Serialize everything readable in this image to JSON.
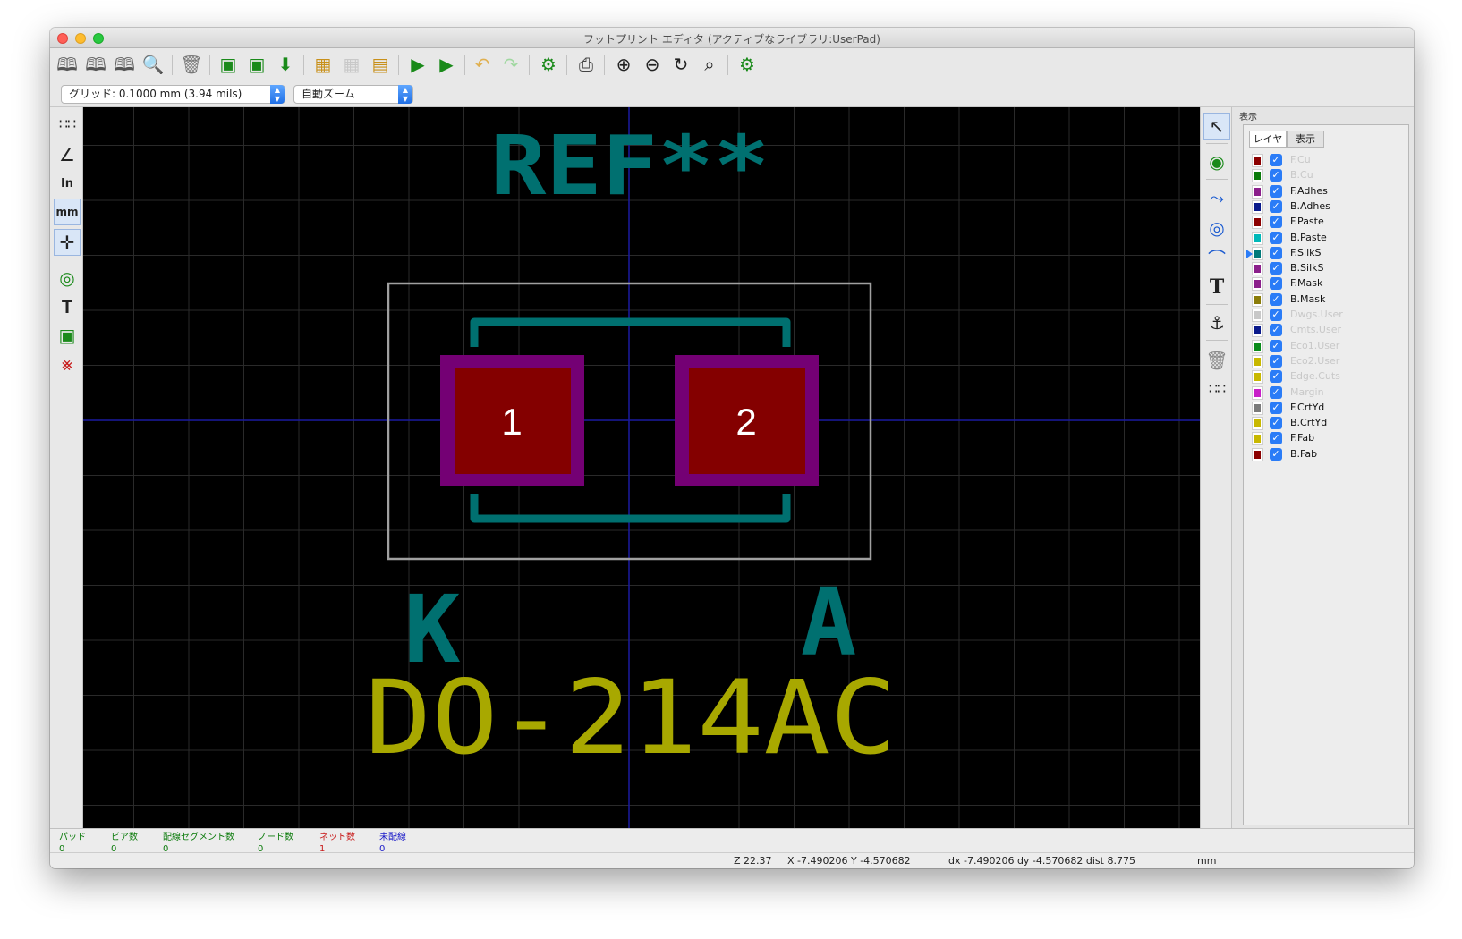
{
  "window": {
    "title": "フットプリント エディタ (アクティブなライブラリ:UserPad)"
  },
  "colors": {
    "canvas_bg": "#000000",
    "silk": "#007070",
    "fab": "#a8a800",
    "pad": "#840000",
    "mask": "#740074",
    "courtyard": "#a0a0a0",
    "axis": "#1a1aa0",
    "grid": "#2a2a2a"
  },
  "toolbar": {
    "icons": [
      "new-library-icon",
      "save-library-icon",
      "open-library-icon",
      "library-browser-icon",
      "delete-icon",
      "new-footprint-icon",
      "create-footprint-wizard-icon",
      "import-footprint-icon",
      "export-footprint-icon",
      "save-footprint-icon",
      "load-from-board-icon",
      "footprint-properties-icon",
      "insert-into-board-icon",
      "update-board-icon",
      "undo-icon",
      "redo-icon",
      "settings-icon",
      "print-icon",
      "zoom-in-icon",
      "zoom-out-icon",
      "redraw-icon",
      "zoom-fit-icon",
      "check-footprint-icon"
    ]
  },
  "options": {
    "grid_value": "グリッド: 0.1000 mm (3.94 mils)",
    "zoom_value": "自動ズーム"
  },
  "left_tools": [
    "grid-toggle-icon",
    "polar-coords-icon",
    "inch-units-icon",
    "mm-units-icon",
    "cursor-shape-icon",
    "pad-sketch-icon",
    "text-sketch-icon",
    "edge-sketch-icon",
    "high-contrast-icon"
  ],
  "left_texts": {
    "inch": "In",
    "mm": "mm"
  },
  "right_tools": [
    "select-arrow-icon",
    "add-pad-icon",
    "add-line-icon",
    "add-circle-icon",
    "add-arc-icon",
    "add-text-icon",
    "anchor-icon",
    "delete-tool-icon",
    "grid-origin-icon"
  ],
  "right_texts": {
    "text_tool": "T"
  },
  "footprint": {
    "ref": "REF**",
    "value": "DO-214AC",
    "cathode": "K",
    "anode": "A",
    "pad1": "1",
    "pad2": "2"
  },
  "panel": {
    "title": "表示",
    "tabs": [
      "レイヤ",
      "表示"
    ],
    "layers": [
      {
        "name": "F.Cu",
        "color": "#8b0000",
        "enabled": false
      },
      {
        "name": "B.Cu",
        "color": "#0a7a0a",
        "enabled": false
      },
      {
        "name": "F.Adhes",
        "color": "#8b1f8b",
        "enabled": true
      },
      {
        "name": "B.Adhes",
        "color": "#0a1a8b",
        "enabled": true
      },
      {
        "name": "F.Paste",
        "color": "#8b0000",
        "enabled": true
      },
      {
        "name": "B.Paste",
        "color": "#00b8b8",
        "enabled": true
      },
      {
        "name": "F.SilkS",
        "color": "#007a7a",
        "enabled": true,
        "active": true
      },
      {
        "name": "B.SilkS",
        "color": "#8b1f8b",
        "enabled": true
      },
      {
        "name": "F.Mask",
        "color": "#8b1f8b",
        "enabled": true
      },
      {
        "name": "B.Mask",
        "color": "#8b7d0a",
        "enabled": true
      },
      {
        "name": "Dwgs.User",
        "color": "#c8c8c8",
        "enabled": false
      },
      {
        "name": "Cmts.User",
        "color": "#0a1a8b",
        "enabled": false
      },
      {
        "name": "Eco1.User",
        "color": "#0a8b1a",
        "enabled": false
      },
      {
        "name": "Eco2.User",
        "color": "#c8b800",
        "enabled": false
      },
      {
        "name": "Edge.Cuts",
        "color": "#c8b800",
        "enabled": false
      },
      {
        "name": "Margin",
        "color": "#c81fc8",
        "enabled": false
      },
      {
        "name": "F.CrtYd",
        "color": "#7a7a7a",
        "enabled": true
      },
      {
        "name": "B.CrtYd",
        "color": "#c8b800",
        "enabled": true
      },
      {
        "name": "F.Fab",
        "color": "#c8b800",
        "enabled": true
      },
      {
        "name": "B.Fab",
        "color": "#8b0000",
        "enabled": true
      }
    ]
  },
  "status": {
    "fields": [
      {
        "label": "パッド",
        "value": "0",
        "color": "#0a7a0a"
      },
      {
        "label": "ビア数",
        "value": "0",
        "color": "#0a7a0a"
      },
      {
        "label": "配線セグメント数",
        "value": "0",
        "color": "#0a7a0a"
      },
      {
        "label": "ノード数",
        "value": "0",
        "color": "#0a7a0a"
      },
      {
        "label": "ネット数",
        "value": "1",
        "color": "#c81a1a"
      },
      {
        "label": "未配線",
        "value": "0",
        "color": "#1a1ac8"
      }
    ],
    "zoom": "Z 22.37",
    "xy": "X -7.490206  Y -4.570682",
    "delta": "dx -7.490206  dy -4.570682  dist 8.775",
    "units": "mm"
  }
}
